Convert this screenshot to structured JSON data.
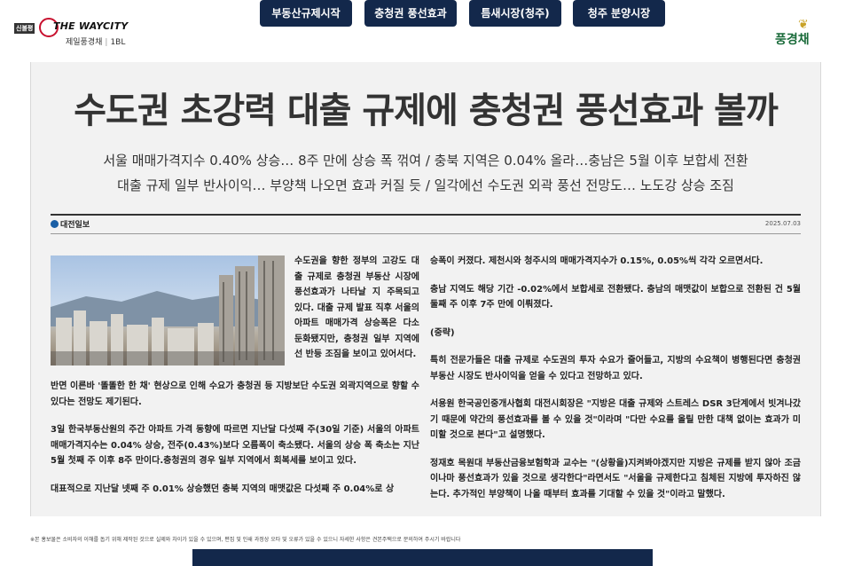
{
  "header": {
    "brand": {
      "tag": "신불평",
      "logo": "THE WAYCITY",
      "sub": "제일풍경채",
      "sub_suffix": "1BL"
    },
    "nav": [
      "부동산규제시작",
      "충청권 풍선효과",
      "틈새시장(청주)",
      "청주 분양시장"
    ],
    "right_logo": "풍경채"
  },
  "article": {
    "headline": "수도권 초강력 대출 규제에 충청권 풍선효과 볼까",
    "subheads": [
      "서울 매매가격지수 0.40% 상승… 8주 만에 상승 폭 꺾여 / 충북 지역은 0.04% 올라…충남은 5월 이후 보합세 전환",
      "대출 규제 일부 반사이익… 부양책 나오면 효과 커질 듯 / 일각에선 수도권 외곽 풍선 전망도… 노도강 상승 조짐"
    ],
    "press": "대전일보",
    "date": "2025.07.03",
    "col1": "수도권을 향한 정부의 고강도 대출 규제로 충청권 부동산 시장에 풍선효과가 나타날 지 주목되고 있다. 대출 규제 발표 직후 서울의 아파트 매매가격 상승폭은 다소 둔화됐지만, 충청권 일부 지역에선 반등 조짐을 보이고 있어서다.",
    "col2": [
      "반면 이른바 '똘똘한 한 채' 현상으로 인해 수요가 충청권 등 지방보단 수도권 외곽지역으로 향할 수 있다는 전망도 제기된다.",
      "3일 한국부동산원의 주간 아파트 가격 동향에 따르면 지난달 다섯째 주(30일 기준) 서울의 아파트 매매가격지수는 0.04% 상승, 전주(0.43%)보다 오름폭이 축소됐다. 서울의 상승 폭 축소는 지난 5월 첫째 주 이후 8주 만이다.충청권의 경우 일부 지역에서 회복세를 보이고 있다.",
      "대표적으로 지난달 넷째 주 0.01% 상승했던 충북 지역의 매맷값은 다섯째 주 0.04%로 상"
    ],
    "col3": [
      "승폭이 커졌다. 제천시와 청주시의 매매가격지수가 0.15%, 0.05%씩 각각 오르면서다.",
      "충남 지역도 해당 기간 -0.02%에서 보합세로 전환됐다. 충남의 매맷값이 보합으로 전환된 건 5월 둘째 주 이후 7주 만에 이뤄졌다.",
      "(중략)",
      "특히 전문가들은 대출 규제로 수도권의 투자 수요가 줄어들고, 지방의 수요책이 병행된다면 충청권 부동산 시장도 반사이익을 얻을 수 있다고 전망하고 있다.",
      "서용원 한국공인중개사협회 대전시회장은 \"지방은 대출 규제와 스트레스 DSR 3단계에서 빗겨나갔기 때문에 약간의 풍선효과를 볼 수 있을 것\"이라며 \"다만 수요를 올릴 만한 대책 없이는 효과가 미미할 것으로 본다\"고 설명했다.",
      "정재호 목원대 부동산금융보험학과 교수는 \"(상황을)지켜봐야겠지만 지방은 규제를 받지 않아 조금이나마 풍선효과가 있을 것으로 생각한다\"라면서도 \"서울을 규제한다고 침체된 지방에 투자하진 않는다. 추가적인 부양책이 나올 때부터 효과를 기대할 수 있을 것\"이라고 말했다."
    ]
  },
  "footnote": "※본 홍보물은 소비자의 이해를 돕기 위해 제작된 것으로 실제와 차이가 있을 수 있으며, 편집 및 인쇄 과정상 오타 및 오류가 있을 수 있으니 자세한 사항은 견본주택으로 문의하여 주시기 바랍니다"
}
